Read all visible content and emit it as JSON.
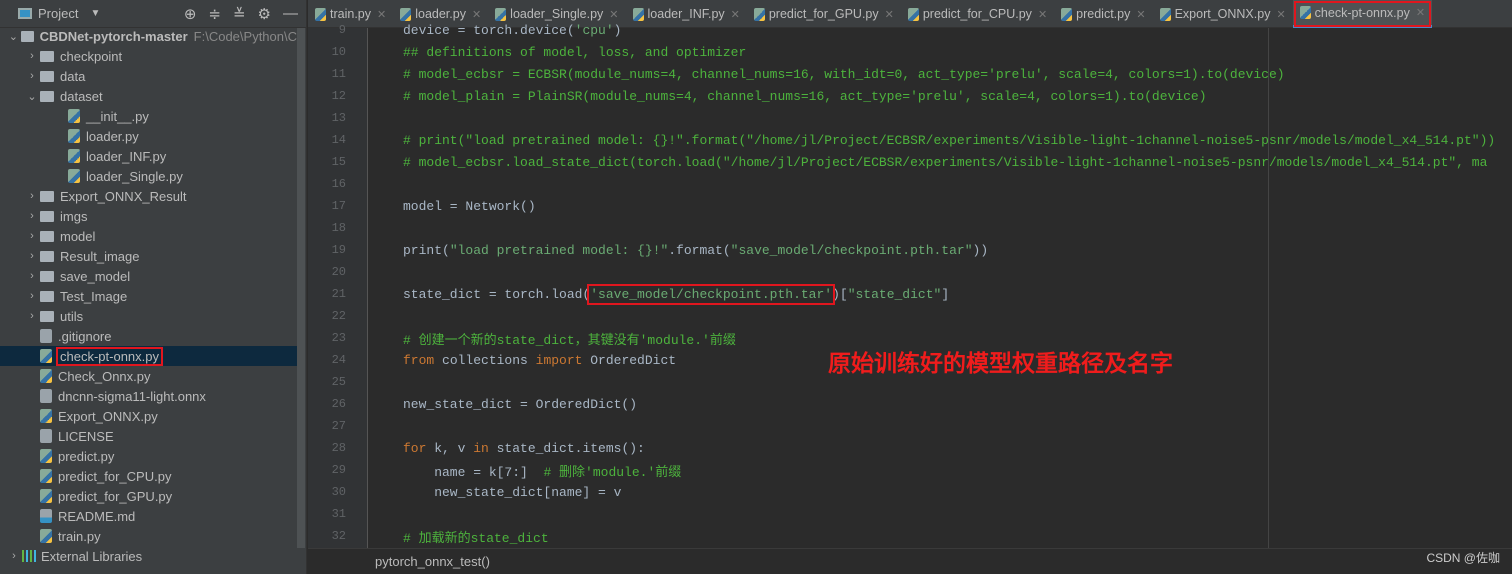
{
  "sidebar": {
    "title": "Project",
    "root": {
      "name": "CBDNet-pytorch-master",
      "path": "F:\\Code\\Python\\C"
    },
    "items": [
      {
        "label": "checkpoint",
        "type": "folder",
        "level": 1,
        "expanded": false
      },
      {
        "label": "data",
        "type": "folder",
        "level": 1,
        "expanded": false
      },
      {
        "label": "dataset",
        "type": "folder",
        "level": 1,
        "expanded": true
      },
      {
        "label": "__init__.py",
        "type": "py",
        "level": 2
      },
      {
        "label": "loader.py",
        "type": "py",
        "level": 2
      },
      {
        "label": "loader_INF.py",
        "type": "py",
        "level": 2
      },
      {
        "label": "loader_Single.py",
        "type": "py",
        "level": 2
      },
      {
        "label": "Export_ONNX_Result",
        "type": "folder",
        "level": 1,
        "expanded": false
      },
      {
        "label": "imgs",
        "type": "folder",
        "level": 1,
        "expanded": false
      },
      {
        "label": "model",
        "type": "folder",
        "level": 1,
        "expanded": false
      },
      {
        "label": "Result_image",
        "type": "folder",
        "level": 1,
        "expanded": false
      },
      {
        "label": "save_model",
        "type": "folder",
        "level": 1,
        "expanded": false
      },
      {
        "label": "Test_Image",
        "type": "folder",
        "level": 1,
        "expanded": false
      },
      {
        "label": "utils",
        "type": "folder",
        "level": 1,
        "expanded": false
      },
      {
        "label": ".gitignore",
        "type": "plain",
        "level": 1
      },
      {
        "label": "check-pt-onnx.py",
        "type": "py",
        "level": 1,
        "selected": true
      },
      {
        "label": "Check_Onnx.py",
        "type": "py",
        "level": 1
      },
      {
        "label": "dncnn-sigma11-light.onnx",
        "type": "plain",
        "level": 1
      },
      {
        "label": "Export_ONNX.py",
        "type": "py",
        "level": 1
      },
      {
        "label": "LICENSE",
        "type": "plain",
        "level": 1
      },
      {
        "label": "predict.py",
        "type": "py",
        "level": 1
      },
      {
        "label": "predict_for_CPU.py",
        "type": "py",
        "level": 1
      },
      {
        "label": "predict_for_GPU.py",
        "type": "py",
        "level": 1
      },
      {
        "label": "README.md",
        "type": "md",
        "level": 1
      },
      {
        "label": "train.py",
        "type": "py",
        "level": 1
      }
    ],
    "external": "External Libraries"
  },
  "tabs": [
    "train.py",
    "loader.py",
    "loader_Single.py",
    "loader_INF.py",
    "predict_for_GPU.py",
    "predict_for_CPU.py",
    "predict.py",
    "Export_ONNX.py",
    "check-pt-onnx.py"
  ],
  "active_tab": "check-pt-onnx.py",
  "code": [
    {
      "n": "9",
      "t": [
        [
          "p",
          "device = torch.device("
        ],
        [
          "s",
          "'cpu'"
        ],
        [
          "p",
          ")"
        ]
      ]
    },
    {
      "n": "10",
      "t": [
        [
          "c",
          "## definitions of model, loss, and optimizer"
        ]
      ]
    },
    {
      "n": "11",
      "t": [
        [
          "c",
          "# model_ecbsr = ECBSR(module_nums=4, channel_nums=16, with_idt=0, act_type='prelu', scale=4, colors=1).to(device)"
        ]
      ]
    },
    {
      "n": "12",
      "t": [
        [
          "c",
          "# model_plain = PlainSR(module_nums=4, channel_nums=16, act_type='prelu', scale=4, colors=1).to(device)"
        ]
      ]
    },
    {
      "n": "13",
      "t": []
    },
    {
      "n": "14",
      "t": [
        [
          "c",
          "# print(\"load pretrained model: {}!\".format(\"/home/jl/Project/ECBSR/experiments/Visible-light-1channel-noise5-psnr/models/model_x4_514.pt\"))"
        ]
      ]
    },
    {
      "n": "15",
      "t": [
        [
          "c",
          "# model_ecbsr.load_state_dict(torch.load(\"/home/jl/Project/ECBSR/experiments/Visible-light-1channel-noise5-psnr/models/model_x4_514.pt\", ma"
        ]
      ]
    },
    {
      "n": "16",
      "t": []
    },
    {
      "n": "17",
      "t": [
        [
          "p",
          "model = Network()"
        ]
      ]
    },
    {
      "n": "18",
      "t": []
    },
    {
      "n": "19",
      "t": [
        [
          "p",
          "print("
        ],
        [
          "s",
          "\"load pretrained model: {}!\""
        ],
        [
          "p",
          ".format("
        ],
        [
          "s",
          "\"save_model/checkpoint.pth.tar\""
        ],
        [
          "p",
          "))"
        ]
      ]
    },
    {
      "n": "20",
      "t": []
    },
    {
      "n": "21",
      "t": [
        [
          "p",
          "state_dict = torch.load("
        ],
        [
          "s hl",
          "'save_model/checkpoint.pth.tar'"
        ],
        [
          "p",
          ")["
        ],
        [
          "s",
          "\"state_dict\""
        ],
        [
          "p",
          "]"
        ]
      ]
    },
    {
      "n": "22",
      "t": []
    },
    {
      "n": "23",
      "t": [
        [
          "c",
          "# 创建一个新的state_dict，其键没有'module.'前缀"
        ]
      ]
    },
    {
      "n": "24",
      "t": [
        [
          "k",
          "from"
        ],
        [
          "p",
          " collections "
        ],
        [
          "k",
          "import"
        ],
        [
          "p",
          " OrderedDict"
        ]
      ]
    },
    {
      "n": "25",
      "t": []
    },
    {
      "n": "26",
      "t": [
        [
          "p",
          "new_state_dict = OrderedDict()"
        ]
      ]
    },
    {
      "n": "27",
      "t": []
    },
    {
      "n": "28",
      "t": [
        [
          "k",
          "for"
        ],
        [
          "p",
          " k, v "
        ],
        [
          "k",
          "in"
        ],
        [
          "p",
          " state_dict.items():"
        ]
      ]
    },
    {
      "n": "29",
      "t": [
        [
          "p",
          "    name = k[7:]  "
        ],
        [
          "c",
          "# 删除'module.'前缀"
        ]
      ]
    },
    {
      "n": "30",
      "t": [
        [
          "p",
          "    new_state_dict[name] = v"
        ]
      ]
    },
    {
      "n": "31",
      "t": []
    },
    {
      "n": "32",
      "t": [
        [
          "c",
          "# 加载新的state_dict"
        ]
      ]
    }
  ],
  "annotation": "原始训练好的模型权重路径及名字",
  "status": {
    "breadcrumb": "pytorch_onnx_test()"
  },
  "watermark": "CSDN @佐咖",
  "colors": {
    "highlight": "#e0161e",
    "comment": "#4db33d",
    "keyword": "#cc7832"
  }
}
